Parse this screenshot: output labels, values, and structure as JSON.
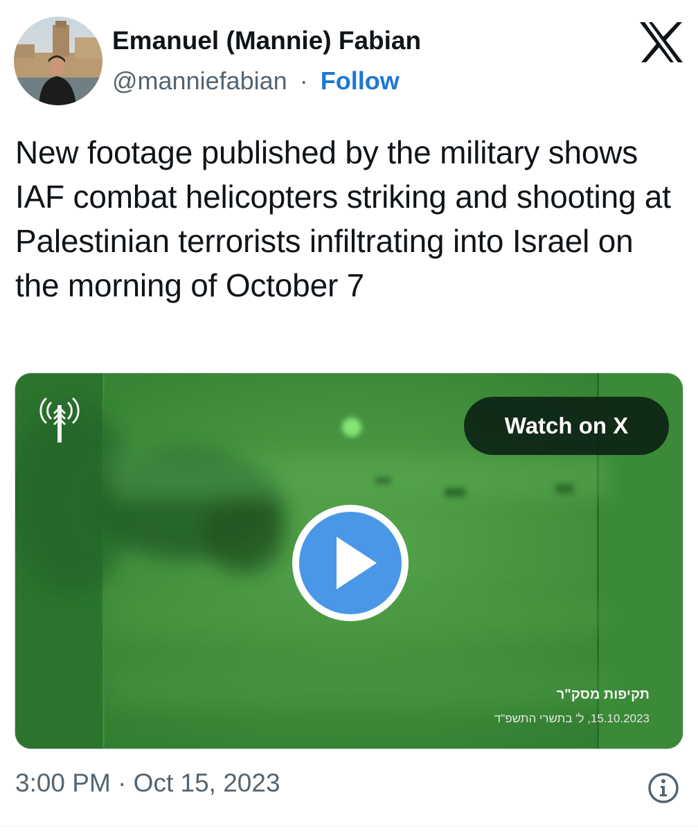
{
  "author": {
    "name": "Emanuel (Mannie) Fabian",
    "handle": "@manniefabian",
    "separator": "·",
    "follow_label": "Follow"
  },
  "tweet": {
    "text": "New footage published by the military shows IAF combat helicopters striking and shooting at Palestinian terrorists infiltrating into Israel on the morning of October 7"
  },
  "media": {
    "watch_label": "Watch on X",
    "caption_title": "תקיפות מסק\"ר",
    "caption_date": "15.10.2023, ל' בתשרי התשפ\"ד"
  },
  "footer": {
    "timestamp": "3:00 PM · Oct 15, 2023"
  },
  "icons": {
    "brand": "x-logo-icon",
    "play": "play-icon",
    "info": "info-icon",
    "channel": "idf-spokesperson-logo-icon"
  },
  "colors": {
    "link": "#1d78d6",
    "play_button": "#4a97e8",
    "video_tint": "#3f8f3a",
    "muted_text": "#536471"
  }
}
